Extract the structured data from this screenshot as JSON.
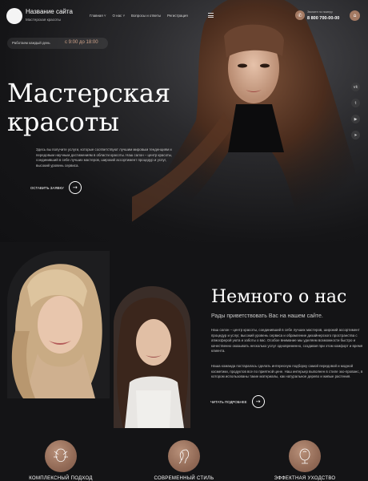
{
  "header": {
    "site_title": "Название сайта",
    "site_subtitle": "Мастерская красоты",
    "nav": [
      "Главная",
      "О нас",
      "Вопросы и ответы",
      "Регистрация"
    ],
    "nav_arrows": [
      "˅",
      "˅"
    ],
    "phone_label": "Звоните по номеру",
    "phone_number": "8 800 700-00-00"
  },
  "hero": {
    "hours_label": "Работаем каждый день",
    "hours_value": "с 9:00 до 18:00",
    "title_line1": "Мастерская",
    "title_line2": "красоты",
    "text": "Здесь вы получите услуги, которые соответствуют лучшим мировым тенденциям и передовым научным достижениям в области красоты. Наш салон – центр красоты, соединивший в себе лучших мастеров, широкий ассортимент процедур и услуг, высокий уровень сервиса.",
    "cta_label": "ОСТАВИТЬ ЗАЯВКУ",
    "cta_arrow": "→"
  },
  "social": [
    "vk",
    "twitter",
    "youtube",
    "telegram"
  ],
  "about": {
    "title": "Немного о нас",
    "subtitle": "Рады приветствовать Вас на нашем сайте.",
    "paragraph1": "Наш салон – центр красоты, соединивший в себе лучших мастеров, широкий ассортимент процедур и услуг, высокий уровень сервиса и обрамление дизайнерского пространства с атмосферой уюта и заботы о вас. Особое внимание мы уделяем возможности быстро и качественно оказывать несколько услуг одновременно, создавая при этом комфорт и время клиента.",
    "paragraph2": "Наша команда постаралась сделать интересную подборку самой передовой и модной косметики, продуктов все по приятной цене. Наш интерьер выполнен в стиле эко-прованс, в котором использованы такие материалы, как натуральное дерево и живые растения.",
    "more_label": "ЧИТАТЬ ПОДРОБНЕЕ",
    "more_arrow": "→"
  },
  "services": [
    {
      "label": "КОМПЛЕКСНЫЙ ПОДХОД",
      "icon": "face-lines-icon"
    },
    {
      "label": "СОВРЕМЕННЫЙ СТИЛЬ",
      "icon": "hair-profile-icon"
    },
    {
      "label": "ЭФФЕКТНАЯ УХОДСТВО",
      "icon": "mirror-icon"
    }
  ],
  "colors": {
    "accent": "#a47a63",
    "background": "#141416",
    "hours_accent": "#d0a38a"
  }
}
